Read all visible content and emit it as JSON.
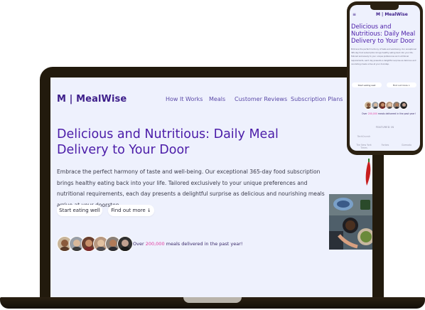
{
  "brand": {
    "logo": "M | MealWise"
  },
  "nav": [
    "How It Works",
    "Meals",
    "Customer Reviews",
    "Subscription Plans"
  ],
  "hero": {
    "title": "Delicious and Nutritious: Daily Meal Delivery to Your Door",
    "body": "Embrace the perfect harmony of taste and well-being. Our exceptional 365-day food subscription brings healthy eating back into your life. Tailored exclusively to your unique preferences and nutritional requirements, each day presents a delightful surprise as delicious and nourishing meals arrive at your doorstep.",
    "primary_button": "Start eating well",
    "secondary_button": "Find out more ↓"
  },
  "stats": {
    "prefix": "Over ",
    "highlight": "200,000",
    "suffix": " meals delivered in the past year!"
  },
  "mobile": {
    "menu_icon": "≡",
    "logo": "M | MealWise",
    "primary_button": "Start eating well",
    "secondary_button": "Find out more ↓",
    "featured_label": "FEATURED IN",
    "featured_logos": [
      "TechCrunch",
      "",
      "",
      "The New York Times",
      "Forbes",
      "Gizmodo"
    ]
  },
  "icons": {
    "menu": "hamburger-icon"
  },
  "colors": {
    "primary": "#4b1ca8",
    "highlight": "#e23aa0",
    "background": "#eef1fd",
    "device": "#221a0d"
  }
}
